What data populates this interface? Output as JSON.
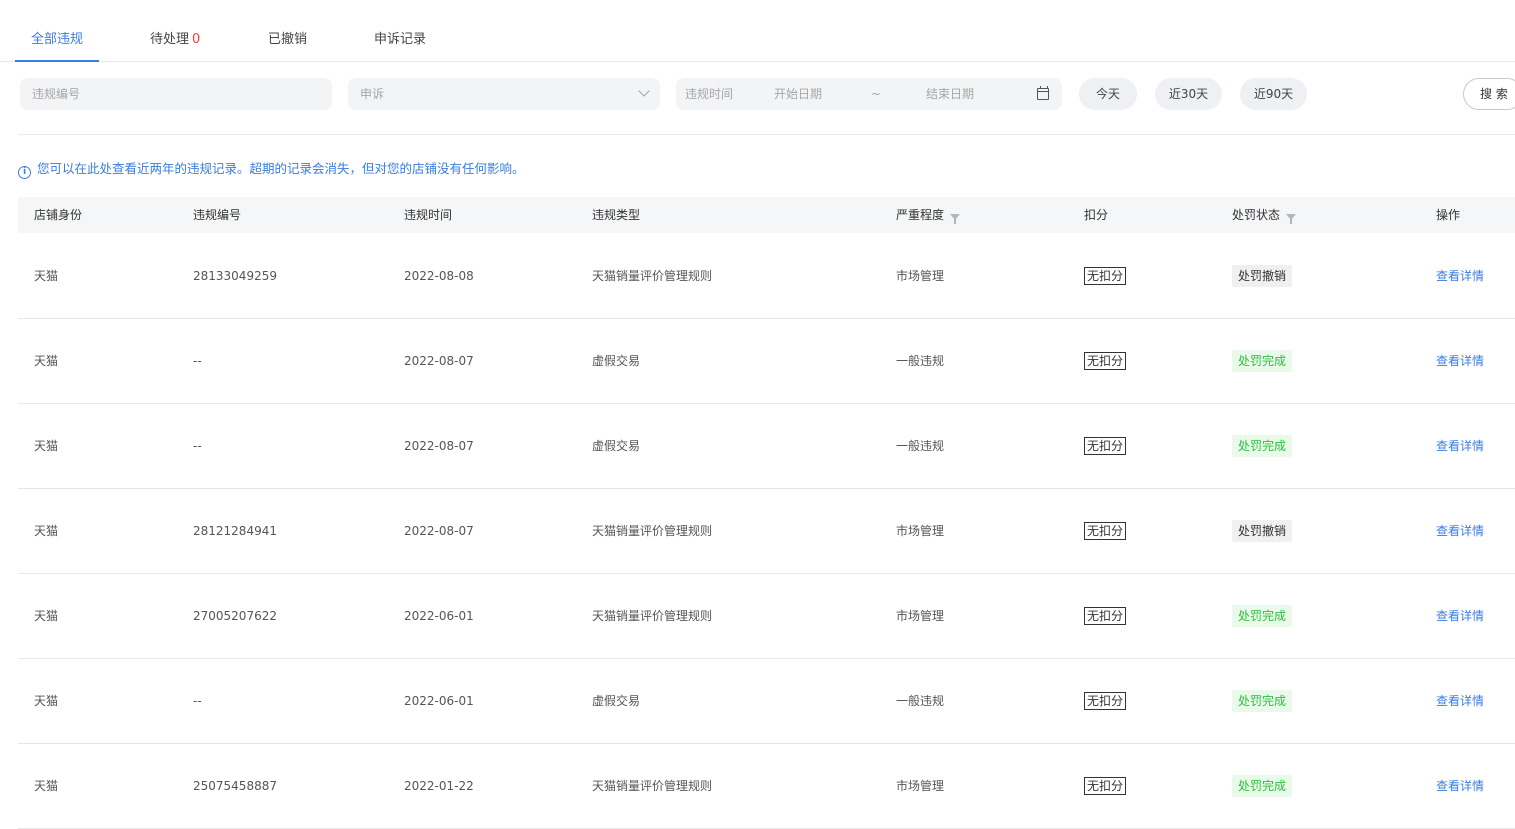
{
  "tabs": [
    {
      "label": "全部违规",
      "active": true
    },
    {
      "label": "待处理",
      "count": "0",
      "active": false
    },
    {
      "label": "已撤销",
      "active": false
    },
    {
      "label": "申诉记录",
      "active": false
    }
  ],
  "filters": {
    "violation_id_placeholder": "违规编号",
    "appeal_select_value": "申诉",
    "date_label": "违规时间",
    "start_placeholder": "开始日期",
    "date_separator": "~",
    "end_placeholder": "结束日期",
    "quick": [
      "今天",
      "近30天",
      "近90天"
    ],
    "search_label": "搜 索"
  },
  "notice": {
    "icon": "info-icon",
    "text": "您可以在此处查看近两年的违规记录。超期的记录会消失，但对您的店铺没有任何影响。"
  },
  "table": {
    "headers": [
      "店铺身份",
      "违规编号",
      "违规时间",
      "违规类型",
      "严重程度",
      "扣分",
      "处罚状态",
      "操作"
    ],
    "rows": [
      {
        "shop": "天猫",
        "id": "28133049259",
        "date": "2022-08-08",
        "type": "天猫销量评价管理规则",
        "severity": "市场管理",
        "score": "无扣分",
        "status": "处罚撤销",
        "status_kind": "revoked",
        "action": "查看详情"
      },
      {
        "shop": "天猫",
        "id": "--",
        "date": "2022-08-07",
        "type": "虚假交易",
        "severity": "一般违规",
        "score": "无扣分",
        "status": "处罚完成",
        "status_kind": "done",
        "action": "查看详情"
      },
      {
        "shop": "天猫",
        "id": "--",
        "date": "2022-08-07",
        "type": "虚假交易",
        "severity": "一般违规",
        "score": "无扣分",
        "status": "处罚完成",
        "status_kind": "done",
        "action": "查看详情"
      },
      {
        "shop": "天猫",
        "id": "28121284941",
        "date": "2022-08-07",
        "type": "天猫销量评价管理规则",
        "severity": "市场管理",
        "score": "无扣分",
        "status": "处罚撤销",
        "status_kind": "revoked",
        "action": "查看详情"
      },
      {
        "shop": "天猫",
        "id": "27005207622",
        "date": "2022-06-01",
        "type": "天猫销量评价管理规则",
        "severity": "市场管理",
        "score": "无扣分",
        "status": "处罚完成",
        "status_kind": "done",
        "action": "查看详情"
      },
      {
        "shop": "天猫",
        "id": "--",
        "date": "2022-06-01",
        "type": "虚假交易",
        "severity": "一般违规",
        "score": "无扣分",
        "status": "处罚完成",
        "status_kind": "done",
        "action": "查看详情"
      },
      {
        "shop": "天猫",
        "id": "25075458887",
        "date": "2022-01-22",
        "type": "天猫销量评价管理规则",
        "severity": "市场管理",
        "score": "无扣分",
        "status": "处罚完成",
        "status_kind": "done",
        "action": "查看详情"
      }
    ]
  },
  "colors": {
    "accent": "#3a7de0",
    "count_red": "#ff3b30",
    "done_green": "#2fbf40"
  }
}
